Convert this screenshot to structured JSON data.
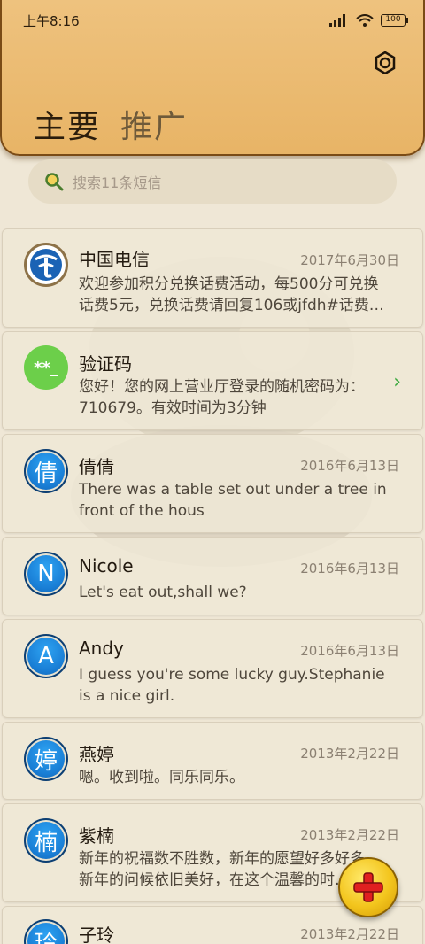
{
  "status": {
    "time": "上午8:16",
    "battery": "100"
  },
  "tabs": [
    {
      "label": "主要"
    },
    {
      "label": "推广"
    }
  ],
  "search": {
    "placeholder": "搜索11条短信"
  },
  "messages": [
    {
      "name": "中国电信",
      "date": "2017年6月30日",
      "preview": "欢迎参加积分兑换话费活动，每500分可兑换话费5元，兑换话费请回复106或jfdh#话费…"
    },
    {
      "name": "验证码",
      "date": "",
      "preview": "您好！您的网上营业厅登录的随机密码为：710679。有效时间为3分钟",
      "avatar": "**_"
    },
    {
      "name": "倩倩",
      "date": "2016年6月13日",
      "preview": "There was a table set out under a tree in front of the hous",
      "avatar": "倩"
    },
    {
      "name": "Nicole",
      "date": "2016年6月13日",
      "preview": "Let's eat out,shall we?",
      "avatar": "N"
    },
    {
      "name": "Andy",
      "date": "2016年6月13日",
      "preview": "I guess you're some lucky guy.Stephanie is a nice girl.",
      "avatar": "A"
    },
    {
      "name": "燕婷",
      "date": "2013年2月22日",
      "preview": "嗯。收到啦。同乐同乐。",
      "avatar": "婷"
    },
    {
      "name": "紫楠",
      "date": "2013年2月22日",
      "preview": "新年的祝福数不胜数，新年的愿望好多好多，新年的问候依旧美好，在这个温馨的时…",
      "avatar": "楠"
    },
    {
      "name": "子玲",
      "date": "2013年2月22日",
      "preview": "",
      "avatar": "玲"
    }
  ],
  "colors": {
    "accent": "#e8b466",
    "avatar_blue": "#1a7fd6",
    "fab": "#f3c51d"
  }
}
